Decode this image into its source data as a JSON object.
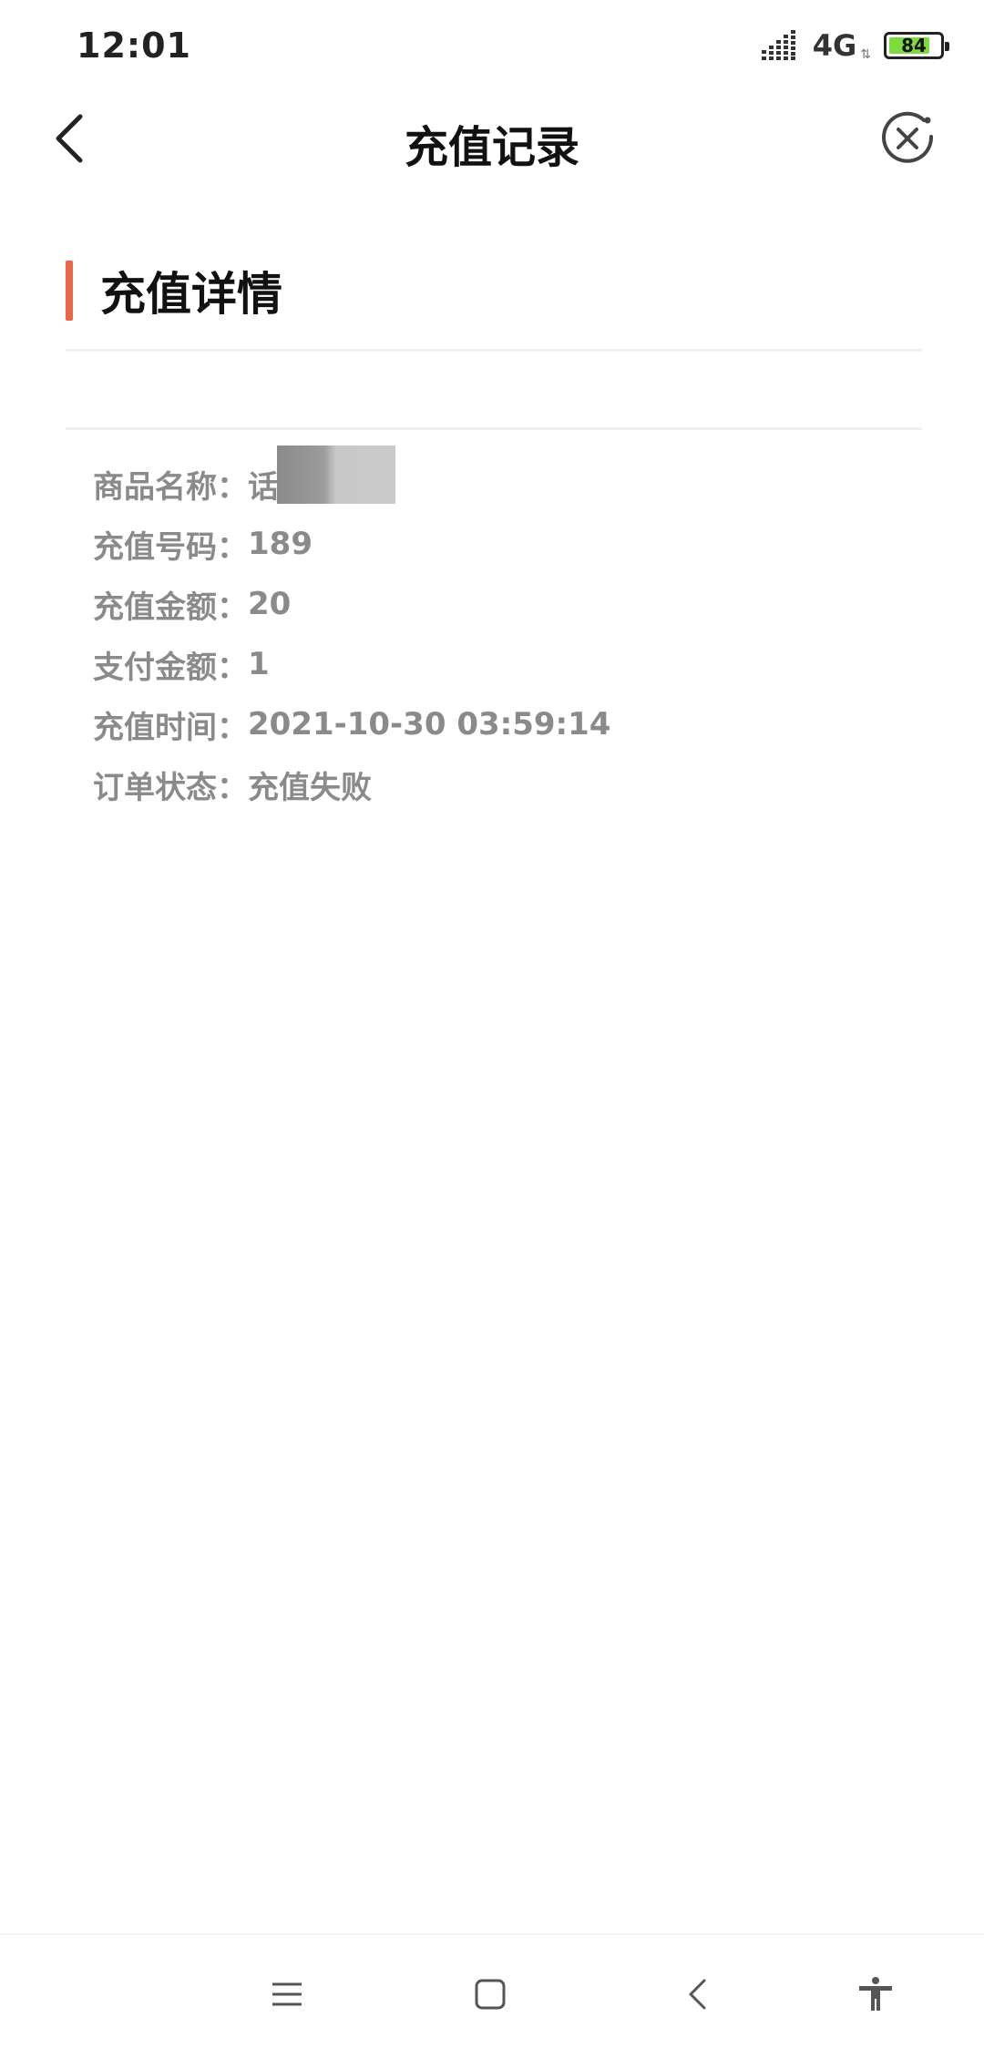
{
  "status_bar": {
    "time": "12:01",
    "network": "4G",
    "battery_level": "84",
    "battery_fraction": 0.84,
    "icons": [
      "signal-icon",
      "battery-icon"
    ]
  },
  "nav": {
    "title": "充值记录",
    "back_icon": "back-arrow-icon",
    "close_icon": "close-circle-icon"
  },
  "section": {
    "title": "充值详情",
    "accent_color": "#e8674a"
  },
  "details": [
    {
      "label": "商品名称：",
      "value": "话费"
    },
    {
      "label": "充值号码：",
      "value": "189"
    },
    {
      "label": "充值金额：",
      "value": "20"
    },
    {
      "label": "支付金额：",
      "value": "1"
    },
    {
      "label": "充值时间：",
      "value": "2021-10-30 03:59:14"
    },
    {
      "label": "订单状态：",
      "value": "充值失败"
    }
  ],
  "system_nav": {
    "icons": [
      "menu-icon",
      "home-icon",
      "back-icon",
      "accessibility-icon"
    ]
  }
}
